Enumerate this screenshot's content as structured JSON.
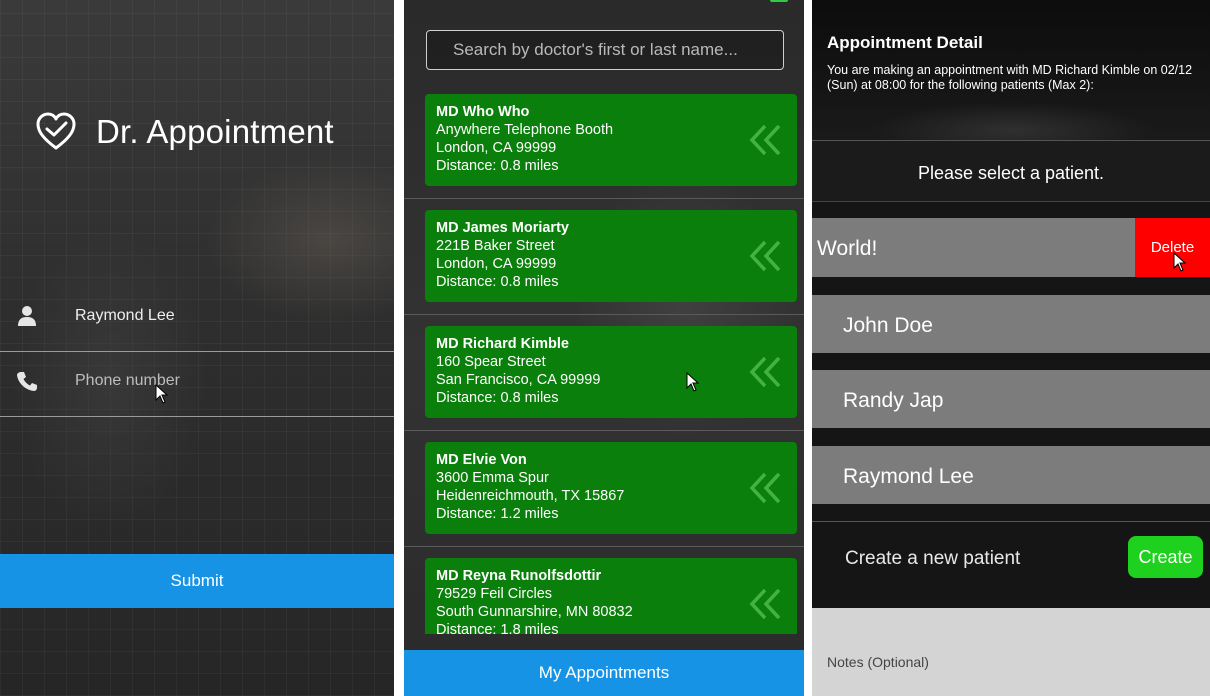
{
  "login": {
    "app_title": "Dr. Appointment",
    "name_value": "Raymond Lee",
    "phone_placeholder": "Phone number",
    "submit_label": "Submit",
    "icons": [
      "heart-check-icon",
      "user-icon",
      "phone-icon",
      "cursor-icon"
    ]
  },
  "doctors": {
    "search_placeholder": "Search by doctor's first or last name...",
    "items": [
      {
        "name": "MD Who Who",
        "street": "Anywhere Telephone Booth",
        "city": "London, CA 99999",
        "distance": "Distance: 0.8 miles"
      },
      {
        "name": "MD James Moriarty",
        "street": "221B Baker Street",
        "city": "London, CA 99999",
        "distance": "Distance: 0.8 miles"
      },
      {
        "name": "MD Richard Kimble",
        "street": "160 Spear Street",
        "city": "San Francisco, CA 99999",
        "distance": "Distance: 0.8 miles"
      },
      {
        "name": "MD Elvie Von",
        "street": "3600 Emma Spur",
        "city": "Heidenreichmouth, TX 15867",
        "distance": "Distance: 1.2 miles"
      },
      {
        "name": "MD Reyna Runolfsdottir",
        "street": "79529 Feil Circles",
        "city": "South Gunnarshire, MN 80832",
        "distance": "Distance: 1.8 miles"
      }
    ],
    "card_icon": "double-chevron-left-icon",
    "my_appointments_label": "My Appointments",
    "colors": {
      "card": "#0b7f0b",
      "primary": "#1793e6"
    }
  },
  "detail": {
    "title": "Appointment Detail",
    "description": "You are making an appointment with MD Richard Kimble on 02/12 (Sun) at 08:00 for the following patients (Max 2):",
    "select_prompt": "Please select a patient.",
    "swiped_patient": "World!",
    "delete_label": "Delete",
    "patients": [
      "John Doe",
      "Randy Jap",
      "Raymond Lee"
    ],
    "create_prompt": "Create a new patient",
    "create_label": "Create",
    "notes_label": "Notes (Optional)",
    "colors": {
      "delete": "#ff0000",
      "create": "#1fd11f",
      "patient_row": "#7c7c7c"
    }
  }
}
